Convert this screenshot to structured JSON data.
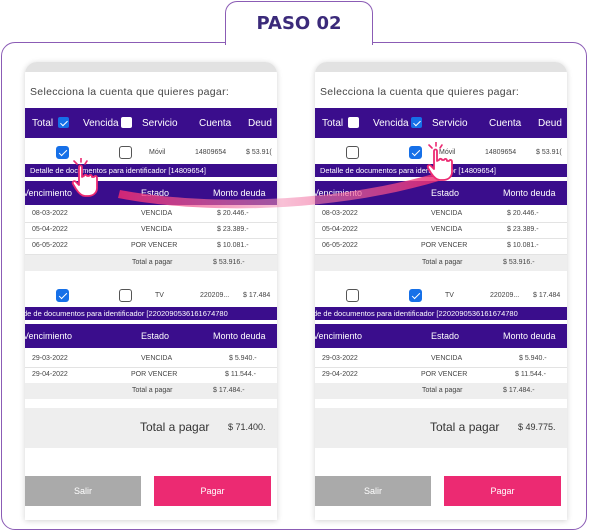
{
  "badge": "PASO 02",
  "common": {
    "title": "Selecciona la cuenta que quieres pagar:",
    "headers": {
      "total": "Total",
      "vencida": "Vencida",
      "servicio": "Servicio",
      "cuenta": "Cuenta",
      "deuda": "Deud"
    },
    "sub_headers": {
      "vencimiento": "Vencimiento",
      "estado": "Estado",
      "monto": "Monto deuda"
    },
    "total_label": "Total a pagar",
    "salir": "Salir",
    "pagar": "Pagar"
  },
  "left": {
    "header_total_checked": true,
    "header_vencida_checked": false,
    "row1": {
      "total_checked": true,
      "vencida_checked": false,
      "servicio": "Móvil",
      "cuenta": "14809654",
      "deuda": "$ 53.91("
    },
    "detail1": "Detalle de documentos para identificador [14809654]",
    "docs1": [
      {
        "fecha": "08-03-2022",
        "estado": "VENCIDA",
        "monto": "$ 20.446.-"
      },
      {
        "fecha": "05-04-2022",
        "estado": "VENCIDA",
        "monto": "$ 23.389.-"
      },
      {
        "fecha": "06-05-2022",
        "estado": "POR VENCER",
        "monto": "$ 10.081.-"
      }
    ],
    "total1": "$ 53.916.-",
    "row2": {
      "total_checked": true,
      "vencida_checked": false,
      "servicio": "TV",
      "cuenta": "220209...",
      "deuda": "$ 17.484"
    },
    "detail2": "de de documentos para identificador [2202090536161674780",
    "docs2": [
      {
        "fecha": "29-03-2022",
        "estado": "VENCIDA",
        "monto": "$ 5.940.-"
      },
      {
        "fecha": "29-04-2022",
        "estado": "POR VENCER",
        "monto": "$ 11.544.-"
      }
    ],
    "total2": "$ 17.484.-",
    "grand_label": "Total a pagar",
    "grand_total": "$ 71.400."
  },
  "right": {
    "header_total_checked": false,
    "header_vencida_checked": true,
    "row1": {
      "total_checked": false,
      "vencida_checked": true,
      "servicio": "Móvil",
      "cuenta": "14809654",
      "deuda": "$ 53.91("
    },
    "detail1": "Detalle de documentos para identificador [14809654]",
    "docs1": [
      {
        "fecha": "08-03-2022",
        "estado": "VENCIDA",
        "monto": "$ 20.446.-"
      },
      {
        "fecha": "05-04-2022",
        "estado": "VENCIDA",
        "monto": "$ 23.389.-"
      },
      {
        "fecha": "06-05-2022",
        "estado": "POR VENCER",
        "monto": "$ 10.081.-"
      }
    ],
    "total1": "$ 53.916.-",
    "row2": {
      "total_checked": false,
      "vencida_checked": true,
      "servicio": "TV",
      "cuenta": "220209...",
      "deuda": "$ 17.484"
    },
    "detail2": "de de documentos para identificador [2202090536161674780",
    "docs2": [
      {
        "fecha": "29-03-2022",
        "estado": "VENCIDA",
        "monto": "$ 5.940.-"
      },
      {
        "fecha": "29-04-2022",
        "estado": "POR VENCER",
        "monto": "$ 11.544.-"
      }
    ],
    "total2": "$ 17.484.-",
    "grand_label": "Total a pagar",
    "grand_total": "$ 49.775."
  },
  "colors": {
    "primary": "#3a0d8c",
    "accent": "#ec2a72",
    "check": "#1670e8",
    "frame": "#8b5cb5"
  },
  "icons": [
    "checkbox-icon",
    "pointer-hand-icon"
  ]
}
